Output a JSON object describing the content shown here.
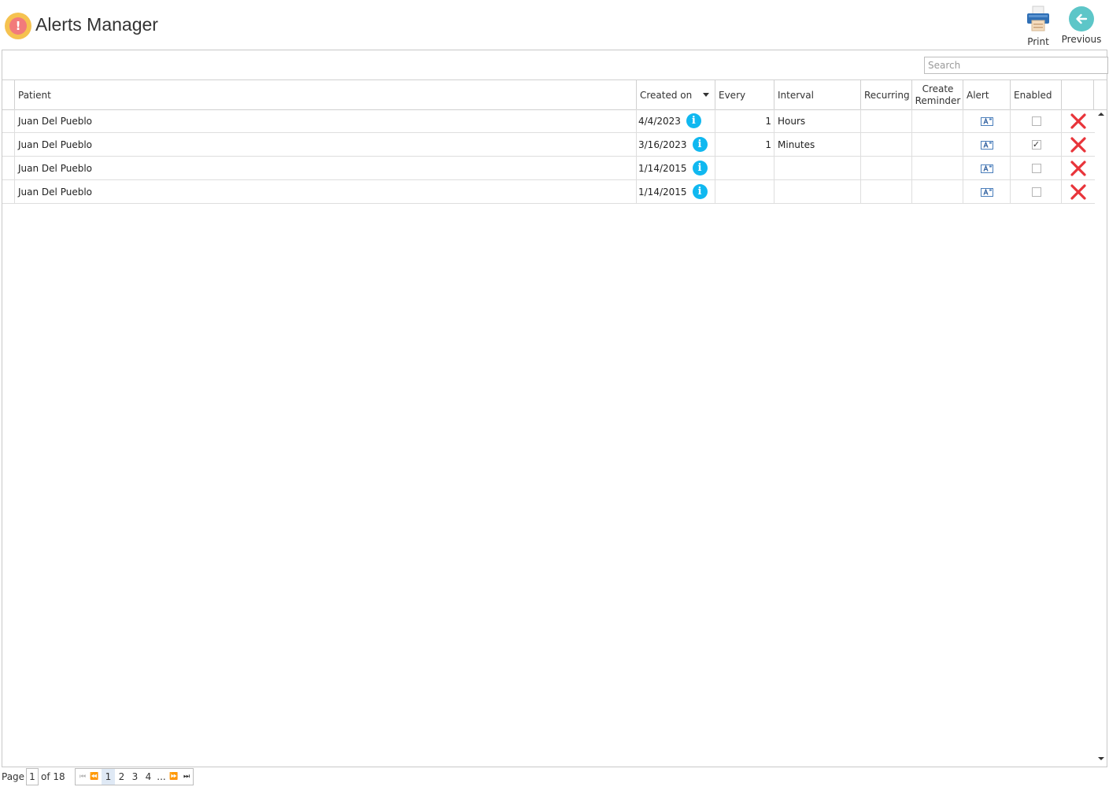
{
  "header": {
    "title": "Alerts Manager",
    "title_icon": "exclamation-circle-icon",
    "print_label": "Print",
    "previous_label": "Previous"
  },
  "search": {
    "placeholder": "Search",
    "value": ""
  },
  "grid": {
    "columns": [
      "Patient",
      "Created on",
      "Every",
      "Interval",
      "Recurring",
      "Create Reminder",
      "Alert",
      "Enabled",
      ""
    ],
    "sorted_column": "Created on",
    "sort_direction": "descending",
    "rows": [
      {
        "patient": "Juan Del Pueblo",
        "created_on": "4/4/2023",
        "every": "1",
        "interval": "Hours",
        "recurring": "",
        "create_reminder": "",
        "enabled": false
      },
      {
        "patient": "Juan Del Pueblo",
        "created_on": "3/16/2023",
        "every": "1",
        "interval": "Minutes",
        "recurring": "",
        "create_reminder": "",
        "enabled": true
      },
      {
        "patient": "Juan Del Pueblo",
        "created_on": "1/14/2015",
        "every": "",
        "interval": "",
        "recurring": "",
        "create_reminder": "",
        "enabled": false
      },
      {
        "patient": "Juan Del Pueblo",
        "created_on": "1/14/2015",
        "every": "",
        "interval": "",
        "recurring": "",
        "create_reminder": "",
        "enabled": false
      }
    ]
  },
  "pager": {
    "page_label": "Page",
    "current_page": "1",
    "of_label": "of 18",
    "pages": [
      "1",
      "2",
      "3",
      "4"
    ],
    "ellipsis": "..."
  },
  "colors": {
    "info": "#10b8f0",
    "delete": "#e8343a",
    "prev_button": "#5dc6c8",
    "title_icon_outer": "#f5c250",
    "title_icon_inner": "#f27b7b"
  }
}
